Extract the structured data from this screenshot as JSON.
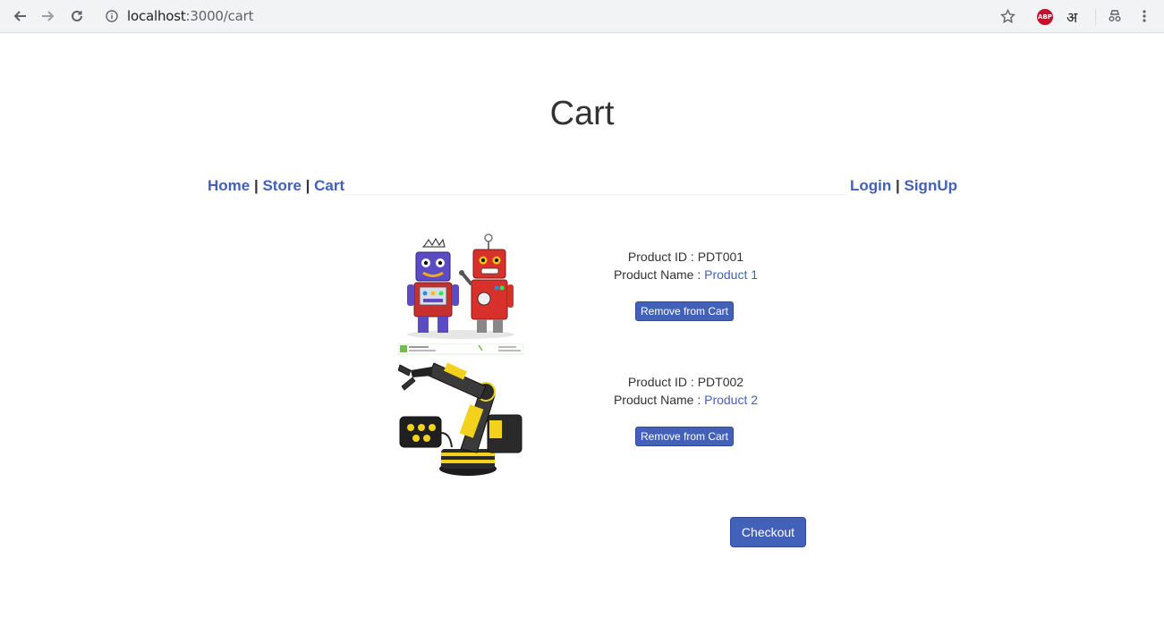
{
  "browser": {
    "url_host": "localhost",
    "url_path": ":3000/cart",
    "extension_abp": "ABP",
    "extension_hindi": "अ"
  },
  "page": {
    "title": "Cart"
  },
  "nav": {
    "home": "Home",
    "store": "Store",
    "cart": "Cart",
    "login": "Login",
    "signup": "SignUp",
    "separator": " | "
  },
  "products": [
    {
      "id_label": "Product ID : ",
      "id": "PDT001",
      "name_label": "Product Name : ",
      "name": "Product 1",
      "remove_label": "Remove from Cart"
    },
    {
      "id_label": "Product ID : ",
      "id": "PDT002",
      "name_label": "Product Name : ",
      "name": "Product 2",
      "remove_label": "Remove from Cart"
    }
  ],
  "checkout_label": "Checkout",
  "colors": {
    "link": "#4361b8",
    "button": "#4361b8"
  }
}
